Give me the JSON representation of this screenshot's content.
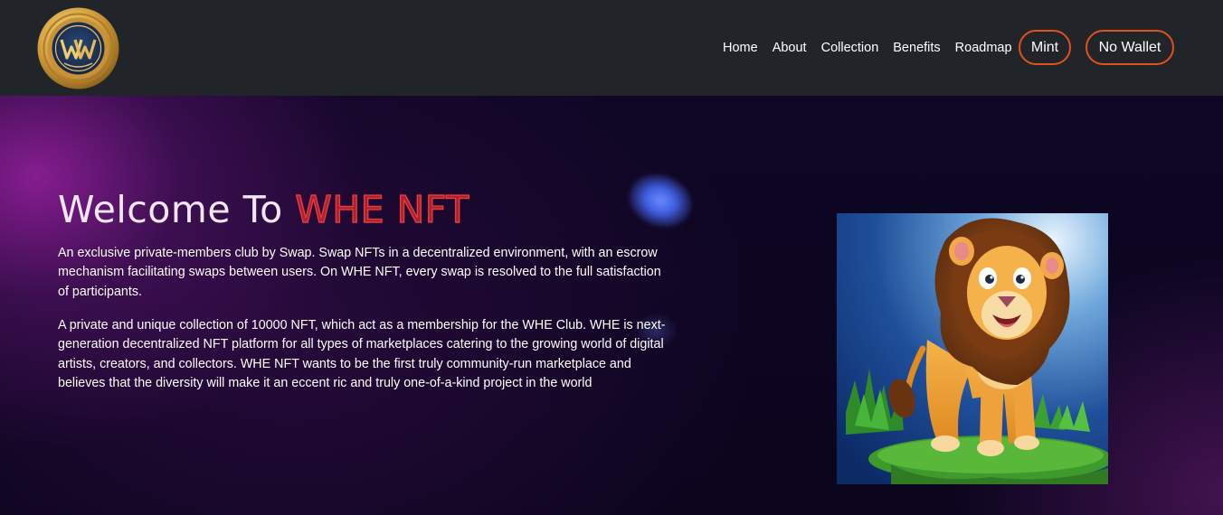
{
  "nav": {
    "logo_icon": "whe-coin-logo",
    "links": [
      "Home",
      "About",
      "Collection",
      "Benefits",
      "Roadmap"
    ],
    "mint_label": "Mint",
    "wallet_label": "No Wallet"
  },
  "hero": {
    "title_prefix": "Welcome To ",
    "title_accent": "WHE NFT",
    "paragraph_1": "An exclusive private-members club by Swap. Swap NFTs in a decentralized environment, with an escrow mechanism facilitating swaps between users. On WHE NFT, every swap is resolved to the full satisfaction of participants.",
    "paragraph_2": "A private and unique collection of 10000 NFT, which act as a membership for the WHE Club. WHE is next-generation decentralized NFT platform for all types of marketplaces catering to the growing world of digital artists, creators, and collectors. WHE NFT wants to be the first truly community-run marketplace and believes that the diversity will make it an eccent ric and truly one-of-a-kind project in the world",
    "image_icon": "cartoon-lion-illustration"
  },
  "colors": {
    "nav_bg": "#212529",
    "accent_orange": "#e2501c",
    "title_red": "#e83a3a",
    "hero_bg": "#0d0620"
  }
}
